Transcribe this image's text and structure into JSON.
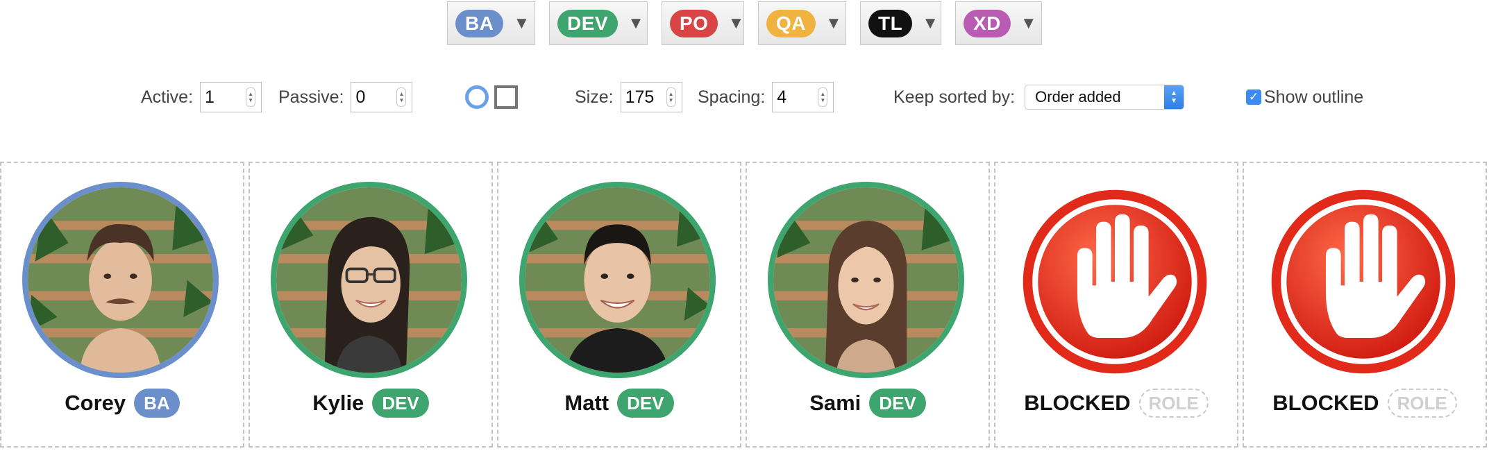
{
  "roles": [
    {
      "label": "BA",
      "color": "#6a8fca"
    },
    {
      "label": "DEV",
      "color": "#3ea56e"
    },
    {
      "label": "PO",
      "color": "#d94545"
    },
    {
      "label": "QA",
      "color": "#f0b340"
    },
    {
      "label": "TL",
      "color": "#111111"
    },
    {
      "label": "XD",
      "color": "#b95bb2"
    }
  ],
  "controls": {
    "active_label": "Active:",
    "active_value": "1",
    "passive_label": "Passive:",
    "passive_value": "0",
    "shape_options": [
      "circle",
      "square"
    ],
    "selected_shape": "circle",
    "size_label": "Size:",
    "size_value": "175",
    "spacing_label": "Spacing:",
    "spacing_value": "4",
    "sort_label": "Keep sorted by:",
    "sort_value": "Order added",
    "outline_label": "Show outline",
    "outline_checked": true
  },
  "cards": [
    {
      "name": "Corey",
      "role": "BA",
      "role_color": "#6a8fca",
      "ring_color": "#6a8fca",
      "type": "person"
    },
    {
      "name": "Kylie",
      "role": "DEV",
      "role_color": "#3ea56e",
      "ring_color": "#3ea56e",
      "type": "person"
    },
    {
      "name": "Matt",
      "role": "DEV",
      "role_color": "#3ea56e",
      "ring_color": "#3ea56e",
      "type": "person"
    },
    {
      "name": "Sami",
      "role": "DEV",
      "role_color": "#3ea56e",
      "ring_color": "#3ea56e",
      "type": "person"
    },
    {
      "name": "BLOCKED",
      "role": "ROLE",
      "role_color": "",
      "ring_color": "",
      "type": "blocked"
    },
    {
      "name": "BLOCKED",
      "role": "ROLE",
      "role_color": "",
      "ring_color": "",
      "type": "blocked"
    }
  ]
}
